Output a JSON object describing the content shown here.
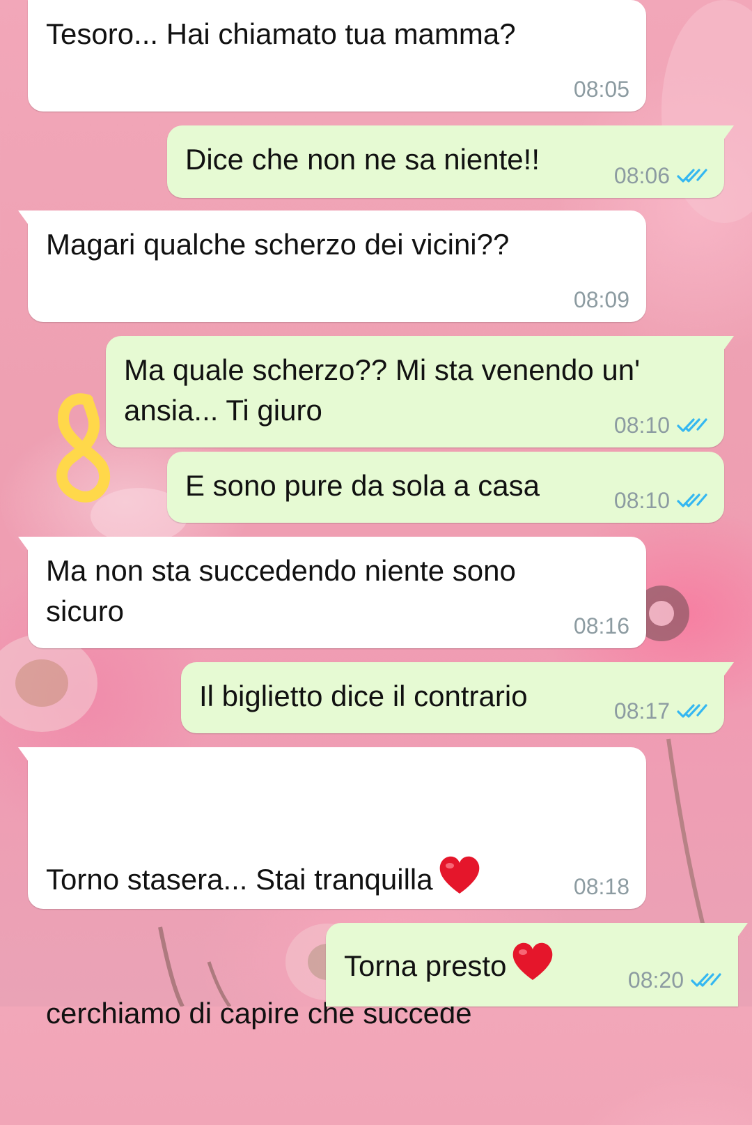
{
  "colors": {
    "incoming_bubble": "#ffffff",
    "outgoing_bubble": "#e6fad3",
    "timestamp": "#8c9ba1",
    "read_ticks": "#34b7f1",
    "doodle": "#ffd84a",
    "heart": "#e5162b"
  },
  "messages": [
    {
      "direction": "incoming",
      "text": "Tesoro... Hai chiamato tua mamma?",
      "time": "08:05"
    },
    {
      "direction": "outgoing",
      "text": "Dice che non ne sa niente!!",
      "time": "08:06",
      "status_icon": "double-check-icon"
    },
    {
      "direction": "incoming",
      "text": "Magari qualche scherzo dei vicini??",
      "time": "08:09"
    },
    {
      "direction": "outgoing",
      "text": "Ma quale scherzo?? Mi sta venendo un'\nansia... Ti giuro",
      "time": "08:10",
      "status_icon": "double-check-icon"
    },
    {
      "direction": "outgoing",
      "text": "E sono pure da sola a casa",
      "time": "08:10",
      "status_icon": "double-check-icon"
    },
    {
      "direction": "incoming",
      "text": "Ma non sta succedendo niente sono\nsicuro",
      "time": "08:16"
    },
    {
      "direction": "outgoing",
      "text": "Il biglietto dice il contrario",
      "time": "08:17",
      "status_icon": "double-check-icon"
    },
    {
      "direction": "incoming",
      "text": "Torno stasera... Stai tranquilla",
      "text_line2": "cerchiamo di capire che succede",
      "emoji": "red-heart-icon",
      "time": "08:18"
    },
    {
      "direction": "outgoing",
      "text": "Torna presto",
      "emoji": "red-heart-icon",
      "time": "08:20",
      "status_icon": "double-check-icon"
    }
  ]
}
